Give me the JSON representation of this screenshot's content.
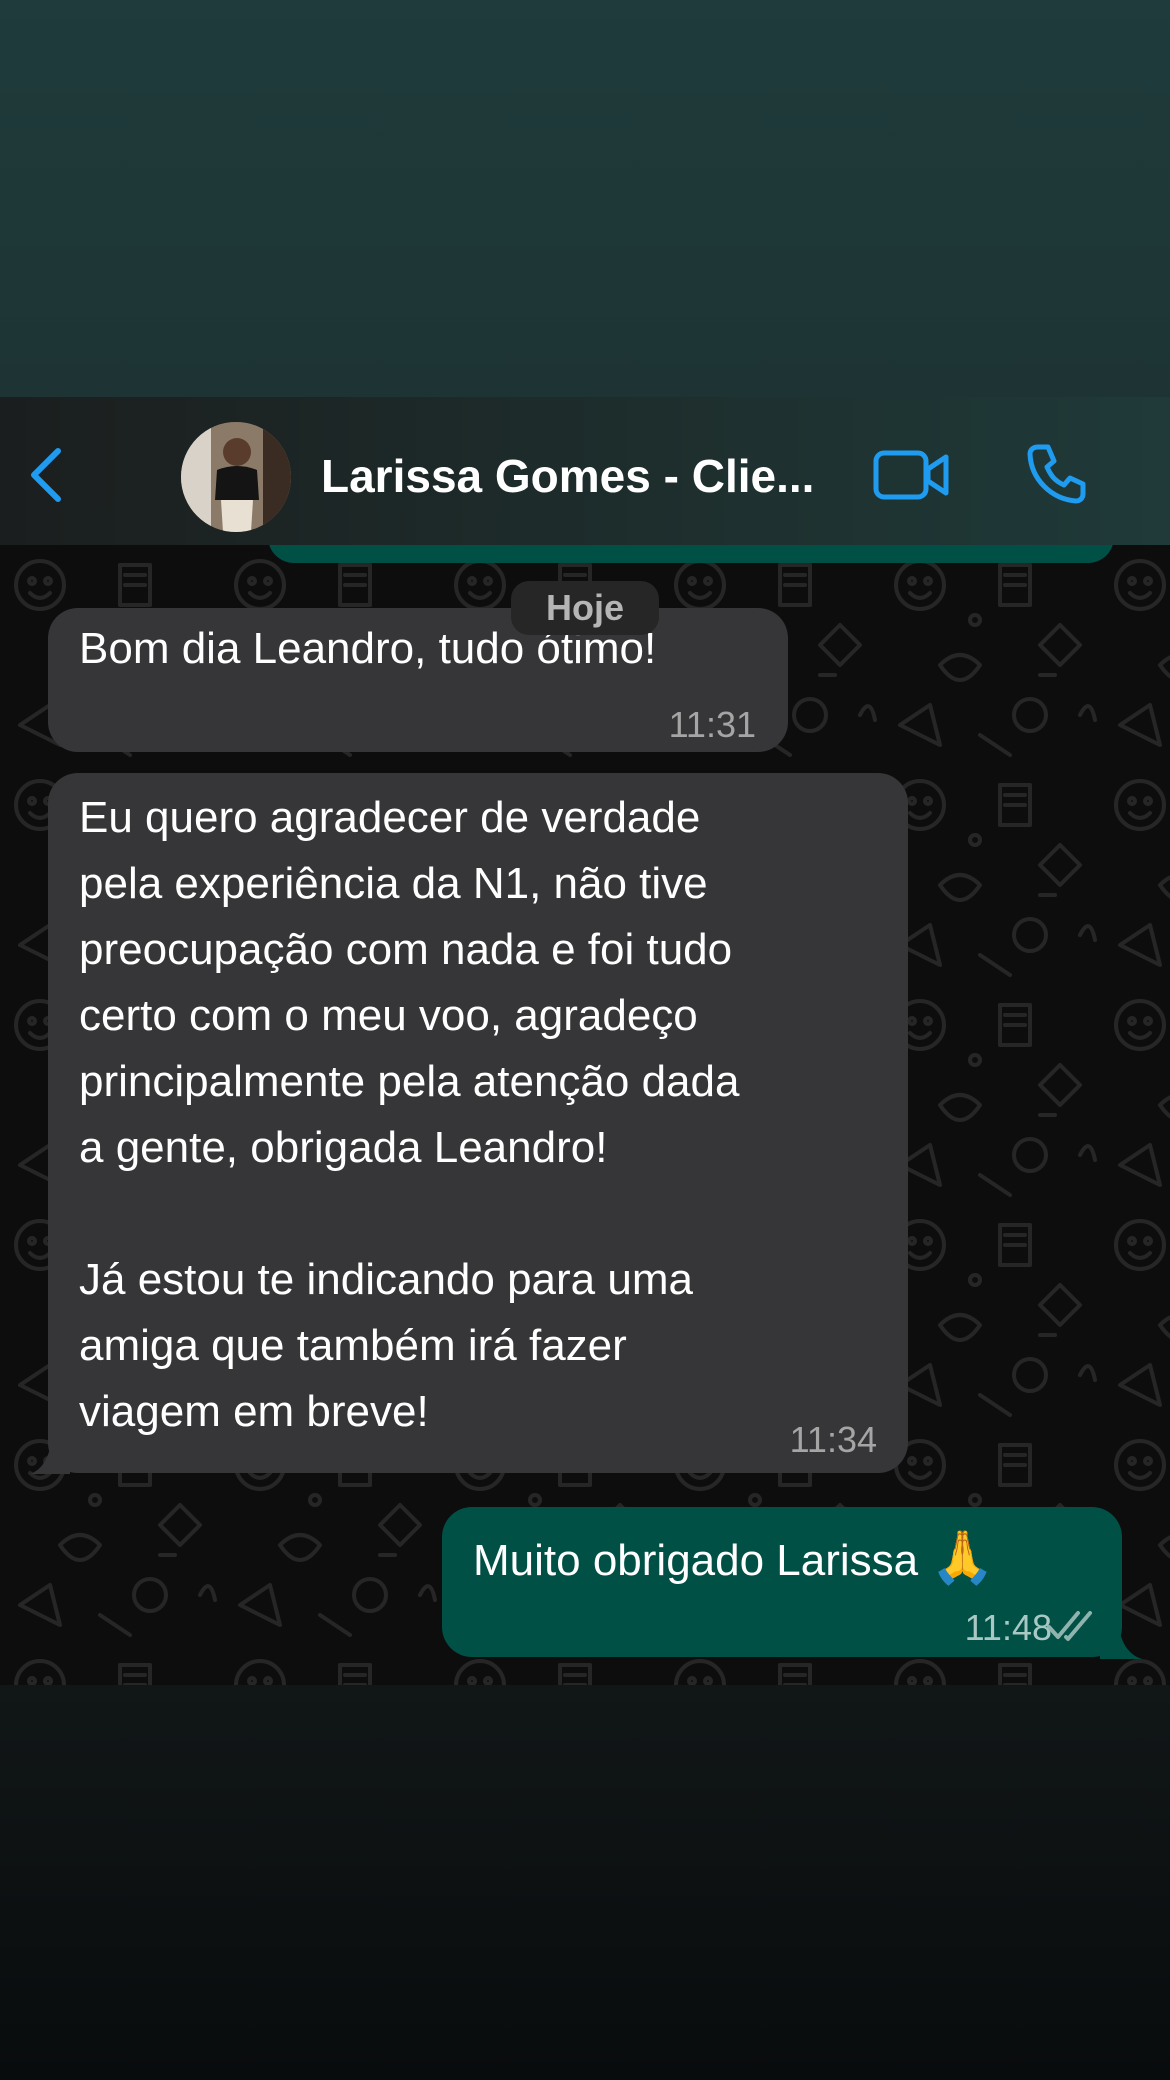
{
  "header": {
    "back_icon": "chevron-left-icon",
    "contact_name": "Larissa Gomes - Clie...",
    "video_icon": "video-camera-icon",
    "phone_icon": "phone-icon",
    "accent_color": "#1f9bf0"
  },
  "chat": {
    "date_label": "Hoje",
    "messages": [
      {
        "direction": "incoming",
        "text": "Bom dia Leandro, tudo ótimo!",
        "time": "11:31"
      },
      {
        "direction": "incoming",
        "text": "Eu quero agradecer de verdade\npela experiência da N1, não tive\npreocupação com nada e foi tudo\ncerto com o meu voo, agradeço\nprincipalmente pela atenção dada\na gente, obrigada Leandro!\n\nJá estou te indicando para uma\namiga que também irá fazer\nviagem em breve!",
        "time": "11:34"
      },
      {
        "direction": "outgoing",
        "text": "Muito obrigado Larissa",
        "emoji": "🙏",
        "time": "11:48",
        "status_icon": "double-check-icon"
      }
    ]
  },
  "colors": {
    "incoming_bubble": "#363638",
    "outgoing_bubble": "#005046",
    "chat_background": "#0d0d0d"
  }
}
